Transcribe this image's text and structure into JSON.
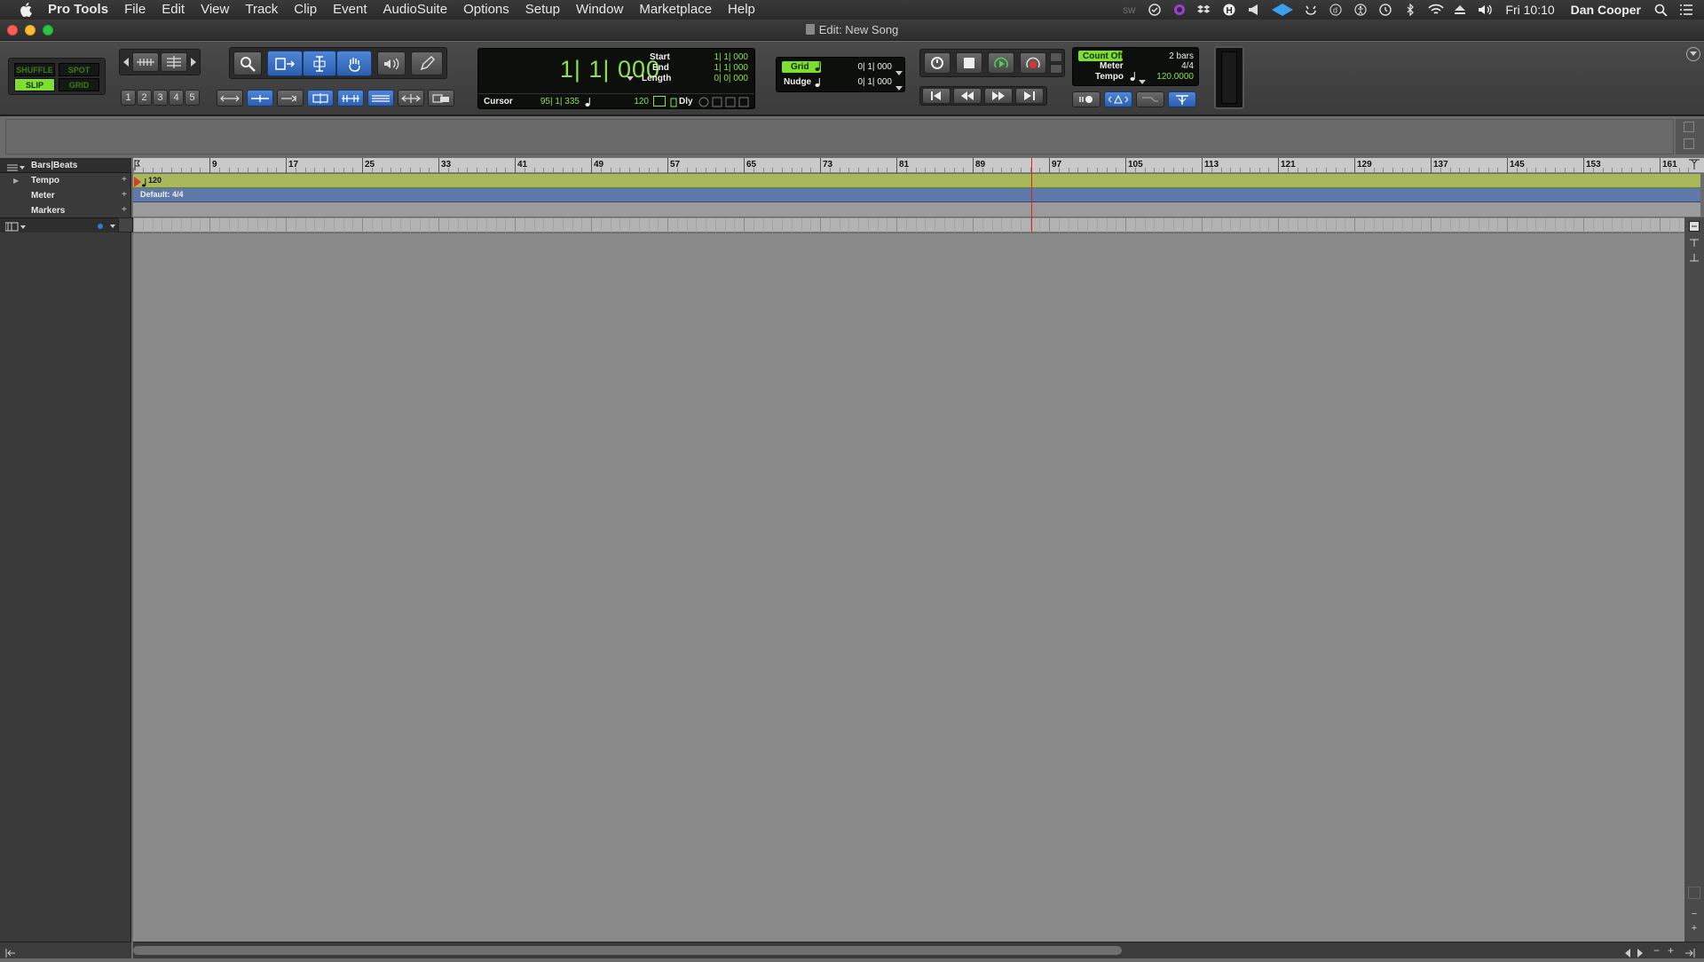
{
  "menubar": {
    "app_name": "Pro Tools",
    "items": [
      "File",
      "Edit",
      "View",
      "Track",
      "Clip",
      "Event",
      "AudioSuite",
      "Options",
      "Setup",
      "Window",
      "Marketplace",
      "Help"
    ],
    "clock": "Fri 10:10",
    "user": "Dan Cooper",
    "status_icons": [
      "sw-icon",
      "checkmark-icon",
      "purple-circle-icon",
      "dropbox-icon",
      "h-badge-icon",
      "megaphone-icon",
      "diamond-icon",
      "cloud-icon",
      "d-icon",
      "accessibility-icon",
      "time-machine-icon",
      "bluetooth-icon",
      "wifi-icon",
      "eject-icon",
      "volume-icon",
      "spotlight-icon",
      "list-icon"
    ]
  },
  "window": {
    "title": "Edit: New Song"
  },
  "edit_modes": {
    "shuffle": "SHUFFLE",
    "spot": "SPOT",
    "slip": "SLIP",
    "grid": "GRID",
    "active": "SLIP"
  },
  "zoom_presets": [
    "1",
    "2",
    "3",
    "4",
    "5"
  ],
  "counter": {
    "main": "1| 1| 000",
    "start_label": "Start",
    "start": "1| 1| 000",
    "end_label": "End",
    "end": "1| 1| 000",
    "length_label": "Length",
    "length": "0| 0| 000",
    "cursor_label": "Cursor",
    "cursor": "95| 1| 335",
    "tempo": "120",
    "dly_label": "Dly"
  },
  "grid_nudge": {
    "grid_label": "Grid",
    "grid_value": "0| 1| 000",
    "nudge_label": "Nudge",
    "nudge_value": "0| 1| 000"
  },
  "midi_panel": {
    "count_off": "Count Off",
    "count_value": "2 bars",
    "meter_label": "Meter",
    "meter_value": "4/4",
    "tempo_label": "Tempo",
    "tempo_value": "120.0000"
  },
  "rulers": {
    "bars_beats_label": "Bars|Beats",
    "tempo_label": "Tempo",
    "meter_label": "Meter",
    "markers_label": "Markers",
    "tempo_value": "120",
    "meter_value": "Default: 4/4",
    "bar_numbers": [
      "9",
      "17",
      "25",
      "33",
      "41",
      "49",
      "57",
      "65",
      "73",
      "81",
      "89",
      "97",
      "105",
      "113",
      "121",
      "129",
      "137",
      "145",
      "153",
      "161"
    ]
  },
  "colors": {
    "lcd_green": "#8fe04a",
    "accent_blue": "#2c5fb0",
    "playhead": "#e02020",
    "tempo_ruler": "#a8b85a",
    "meter_ruler": "#5f7aa9"
  }
}
